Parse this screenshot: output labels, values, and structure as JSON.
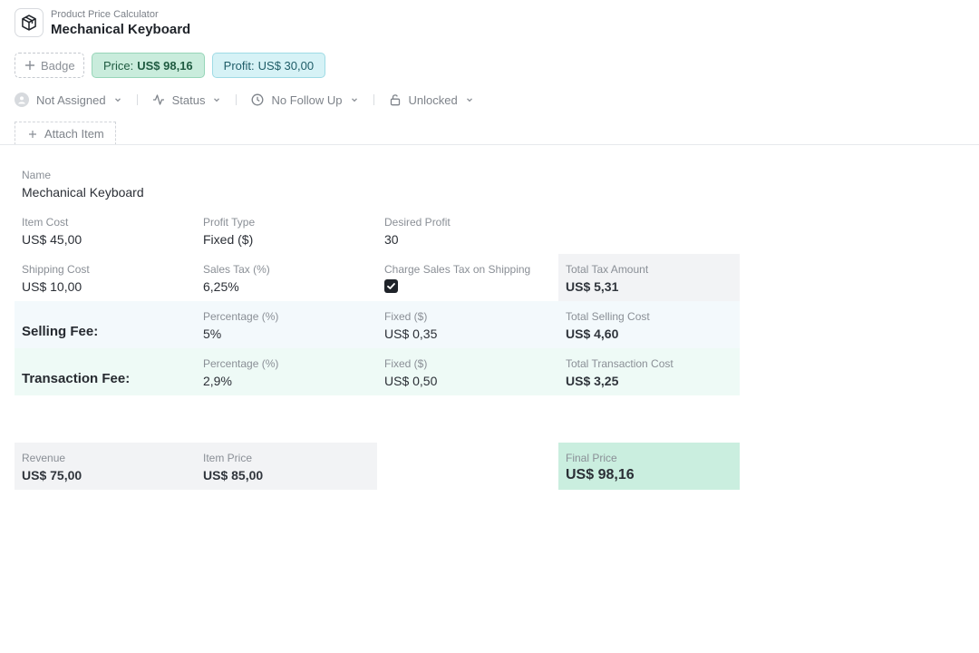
{
  "header": {
    "subtitle": "Product Price Calculator",
    "title": "Mechanical Keyboard",
    "icon": "package-box-icon"
  },
  "badges": {
    "add_label": "Badge",
    "price_label": "Price:",
    "price_value": "US$ 98,16",
    "profit_label": "Profit:",
    "profit_value": "US$ 30,00"
  },
  "meta": {
    "assignee": "Not Assigned",
    "status": "Status",
    "follow_up": "No Follow Up",
    "lock": "Unlocked"
  },
  "attach_label": "Attach Item",
  "fields": {
    "name_label": "Name",
    "name_value": "Mechanical Keyboard",
    "item_cost_label": "Item Cost",
    "item_cost_value": "US$ 45,00",
    "profit_type_label": "Profit Type",
    "profit_type_value": "Fixed ($)",
    "desired_profit_label": "Desired Profit",
    "desired_profit_value": "30",
    "shipping_cost_label": "Shipping Cost",
    "shipping_cost_value": "US$ 10,00",
    "sales_tax_label": "Sales Tax (%)",
    "sales_tax_value": "6,25%",
    "charge_tax_shipping_label": "Charge Sales Tax on Shipping",
    "charge_tax_shipping_checked": true,
    "total_tax_label": "Total Tax Amount",
    "total_tax_value": "US$ 5,31"
  },
  "selling_fee": {
    "row_label": "Selling Fee:",
    "percentage_label": "Percentage (%)",
    "percentage_value": "5%",
    "fixed_label": "Fixed ($)",
    "fixed_value": "US$ 0,35",
    "total_label": "Total Selling Cost",
    "total_value": "US$ 4,60"
  },
  "transaction_fee": {
    "row_label": "Transaction Fee:",
    "percentage_label": "Percentage (%)",
    "percentage_value": "2,9%",
    "fixed_label": "Fixed ($)",
    "fixed_value": "US$ 0,50",
    "total_label": "Total Transaction Cost",
    "total_value": "US$ 3,25"
  },
  "summary": {
    "revenue_label": "Revenue",
    "revenue_value": "US$ 75,00",
    "item_price_label": "Item Price",
    "item_price_value": "US$ 85,00",
    "final_price_label": "Final Price",
    "final_price_value": "US$ 98,16"
  },
  "colors": {
    "price_badge": "#c9ecdc",
    "profit_badge": "#d6f2f6",
    "final_price_bg": "#caeedf",
    "selling_row_bg": "#f3f9fc",
    "transaction_row_bg": "#eefaf6"
  }
}
